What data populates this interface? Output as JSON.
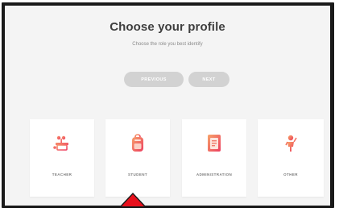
{
  "page": {
    "title": "Choose your profile",
    "subtitle": "Choose the role you best identify"
  },
  "navigation": {
    "previous_label": "PREVIOUS",
    "next_label": "NEXT"
  },
  "profiles": [
    {
      "label": "TEACHER",
      "icon": "teacher-icon"
    },
    {
      "label": "STUDENT",
      "icon": "backpack-icon"
    },
    {
      "label": "ADMINISTRATION",
      "icon": "document-icon"
    },
    {
      "label": "OTHER",
      "icon": "person-icon"
    }
  ],
  "colors": {
    "accent": "#f0565e",
    "button_disabled": "#d2d2d2",
    "pointer": "#e8101c"
  }
}
